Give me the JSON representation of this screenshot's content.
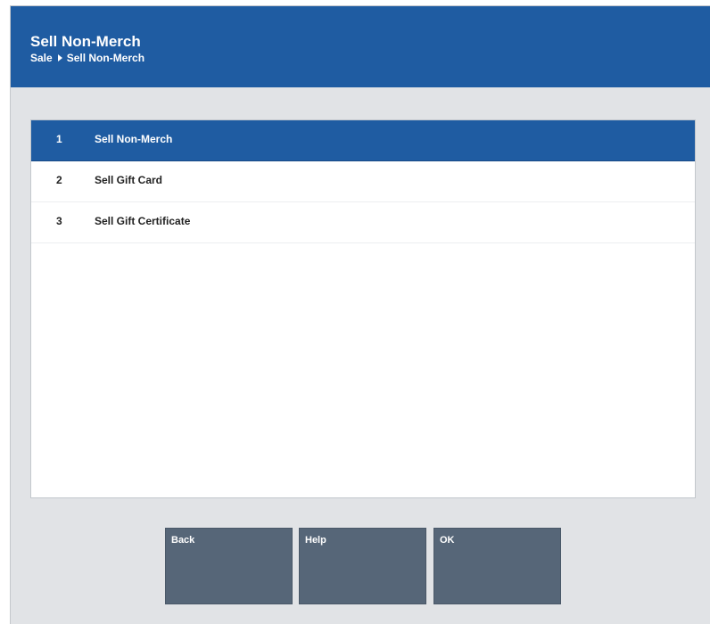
{
  "header": {
    "title": "Sell Non-Merch",
    "breadcrumb": [
      "Sale",
      "Sell Non-Merch"
    ]
  },
  "list": {
    "items": [
      {
        "number": "1",
        "label": "Sell Non-Merch",
        "selected": true
      },
      {
        "number": "2",
        "label": "Sell Gift Card",
        "selected": false
      },
      {
        "number": "3",
        "label": "Sell Gift Certificate",
        "selected": false
      }
    ]
  },
  "buttons": {
    "back": "Back",
    "help": "Help",
    "ok": "OK"
  },
  "colors": {
    "header_bg": "#1f5ca2",
    "selected_row_bg": "#1f5ca2",
    "button_bg": "#566678",
    "panel_bg": "#e1e3e6"
  },
  "icons": {
    "breadcrumb_separator": "caret-right-icon"
  }
}
